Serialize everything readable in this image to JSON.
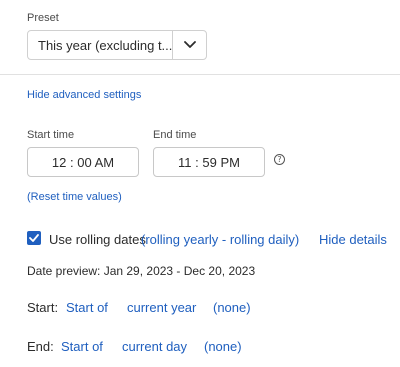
{
  "preset": {
    "label": "Preset",
    "value": "This year (excluding t...",
    "toggle_icon": "chevron-down-icon"
  },
  "advanced": {
    "hide_link": "Hide advanced settings"
  },
  "times": {
    "start_label": "Start time",
    "start_value": "12 : 00  AM",
    "end_label": "End time",
    "end_value": "11 : 59  PM",
    "info_icon": "?"
  },
  "reset_link": "(Reset time values)",
  "rolling": {
    "checked": true,
    "label": "Use rolling dates",
    "detail_link": "(rolling yearly - rolling daily)",
    "hide_details": "Hide details"
  },
  "preview": {
    "text": "Date preview: Jan 29, 2023 - Dec 20, 2023"
  },
  "start_row": {
    "label": "Start:",
    "anchor": "Start of",
    "unit": "current year",
    "offset": "(none)"
  },
  "end_row": {
    "label": "End:",
    "anchor": "Start of",
    "unit": "current day",
    "offset": "(none)"
  },
  "colors": {
    "accent": "#1f5fbf",
    "text": "#2c2c2c",
    "border": "#d0d0d0"
  }
}
